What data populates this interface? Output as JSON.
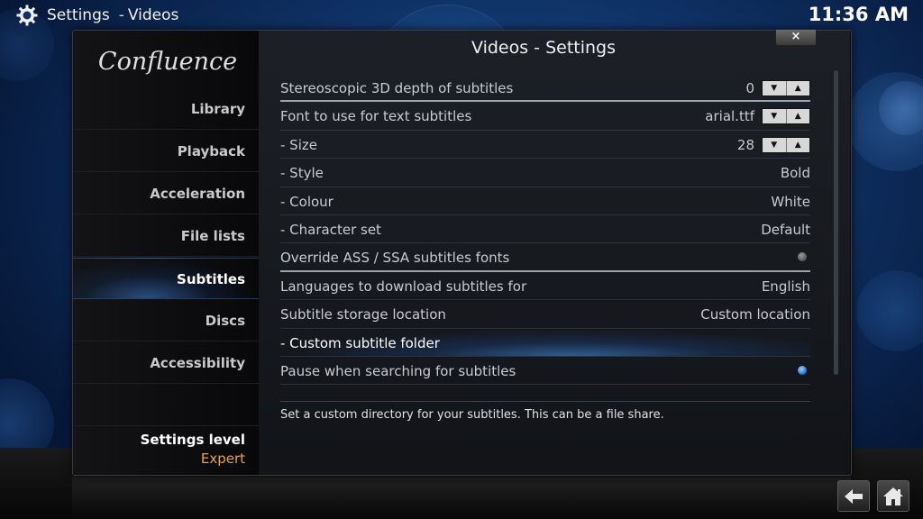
{
  "header": {
    "section": "Settings",
    "separator": "-",
    "subsection": "Videos",
    "clock": "11:36 AM",
    "icon": "gear-icon"
  },
  "dialog": {
    "title": "Videos - Settings",
    "close_label": "×",
    "logo_text": "Confluence"
  },
  "sidebar": {
    "items": [
      {
        "label": "Library"
      },
      {
        "label": "Playback"
      },
      {
        "label": "Acceleration"
      },
      {
        "label": "File lists"
      },
      {
        "label": "Subtitles"
      },
      {
        "label": "Discs"
      },
      {
        "label": "Accessibility"
      }
    ],
    "active_item": "Subtitles",
    "settings_level_label": "Settings level",
    "settings_level_value": "Expert"
  },
  "settings": [
    {
      "label": "Stereoscopic 3D depth of subtitles",
      "value": "0",
      "control": "spinner"
    },
    {
      "label": "Font to use for text subtitles",
      "value": "arial.ttf",
      "control": "spinner"
    },
    {
      "label": "- Size",
      "value": "28",
      "control": "spinner"
    },
    {
      "label": "- Style",
      "value": "Bold",
      "control": "text"
    },
    {
      "label": "- Colour",
      "value": "White",
      "control": "text"
    },
    {
      "label": "- Character set",
      "value": "Default",
      "control": "text"
    },
    {
      "label": "Override ASS / SSA subtitles fonts",
      "control": "radio",
      "checked": false
    },
    {
      "label": "Languages to download subtitles for",
      "value": "English",
      "control": "text"
    },
    {
      "label": "Subtitle storage location",
      "value": "Custom location",
      "control": "text"
    },
    {
      "label": "- Custom subtitle folder",
      "control": "none",
      "focused": true
    },
    {
      "label": "Pause when searching for subtitles",
      "control": "radio",
      "checked": true
    }
  ],
  "spinner_glyphs": {
    "down": "▼",
    "up": "▲"
  },
  "description": "Set a custom directory for your subtitles. This can be a file share.",
  "bottom_buttons": [
    {
      "name": "back-icon"
    },
    {
      "name": "home-icon"
    }
  ],
  "colors": {
    "accent_orange": "#e8a33b",
    "highlight_blue": "#2b7fe0",
    "background_blue": "#0f3266"
  }
}
